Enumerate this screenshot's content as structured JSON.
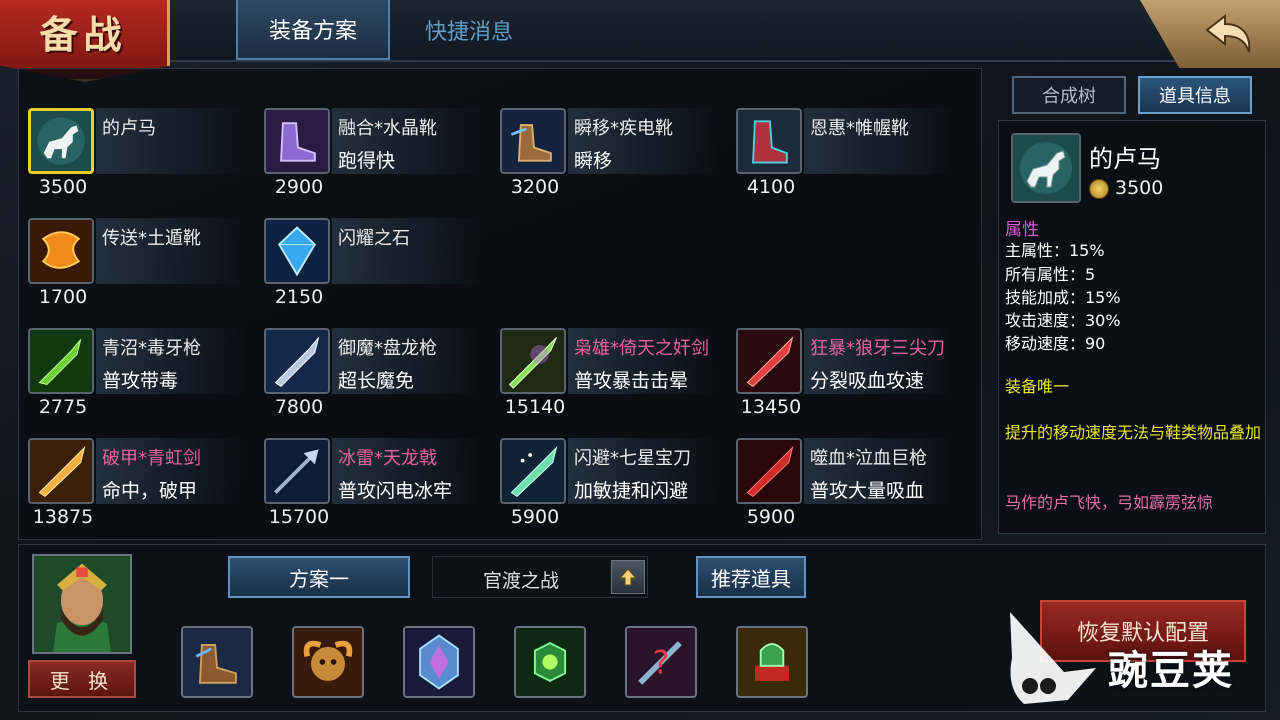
{
  "header": {
    "badge": "备战",
    "tabs": [
      {
        "label": "装备方案",
        "active": true
      },
      {
        "label": "快捷消息",
        "active": false
      }
    ]
  },
  "items": [
    {
      "name": "的卢马",
      "desc": "",
      "price": "3500",
      "name_color": "white",
      "icon": "horse-icon",
      "selected": true
    },
    {
      "name": "融合*水晶靴",
      "desc": "跑得快",
      "price": "2900",
      "name_color": "white",
      "icon": "crystal-boots-icon"
    },
    {
      "name": "瞬移*疾电靴",
      "desc": "瞬移",
      "price": "3200",
      "name_color": "white",
      "icon": "lightning-boots-icon"
    },
    {
      "name": "恩惠*帷幄靴",
      "desc": "",
      "price": "4100",
      "name_color": "white",
      "icon": "red-boots-icon"
    },
    {
      "name": "传送*土遁靴",
      "desc": "",
      "price": "1700",
      "name_color": "white",
      "icon": "fire-boots-icon"
    },
    {
      "name": "闪耀之石",
      "desc": "",
      "price": "2150",
      "name_color": "white",
      "icon": "gem-icon"
    },
    {
      "name": "青沼*毒牙枪",
      "desc": "普攻带毒",
      "price": "2775",
      "name_color": "white",
      "icon": "poison-spear-icon"
    },
    {
      "name": "御魔*盘龙枪",
      "desc": "超长魔免",
      "price": "7800",
      "name_color": "white",
      "icon": "dragon-spear-icon"
    },
    {
      "name": "枭雄*倚天之奸剑",
      "desc": "普攻暴击击晕",
      "price": "15140",
      "name_color": "pink",
      "icon": "green-sword-icon"
    },
    {
      "name": "狂暴*狼牙三尖刀",
      "desc": "分裂吸血攻速",
      "price": "13450",
      "name_color": "pink",
      "icon": "red-blade-icon"
    },
    {
      "name": "破甲*青虹剑",
      "desc": "命中，破甲",
      "price": "13875",
      "name_color": "pink",
      "icon": "golden-sword-icon"
    },
    {
      "name": "冰雷*天龙戟",
      "desc": "普攻闪电冰牢",
      "price": "15700",
      "name_color": "pink",
      "icon": "halberd-icon"
    },
    {
      "name": "闪避*七星宝刀",
      "desc": "加敏捷和闪避",
      "price": "5900",
      "name_color": "white",
      "icon": "seven-star-blade-icon"
    },
    {
      "name": "噬血*泣血巨枪",
      "desc": "普攻大量吸血",
      "price": "5900",
      "name_color": "white",
      "icon": "blood-spear-icon"
    }
  ],
  "right_tabs": [
    {
      "label": "合成树",
      "active": false
    },
    {
      "label": "道具信息",
      "active": true
    }
  ],
  "detail": {
    "name": "的卢马",
    "price": "3500",
    "attr_title": "属性",
    "attrs": [
      "主属性：15%",
      "所有属性：5",
      "技能加成：15%",
      "攻击速度：30%",
      "移动速度：90"
    ],
    "unique": "装备唯一",
    "note": "提升的移动速度无法与鞋类物品叠加",
    "lore": "马作的卢飞快，弓如霹雳弦惊"
  },
  "bottom": {
    "swap_label": "更 换",
    "plan_label": "方案一",
    "map_label": "官渡之战",
    "recommend_label": "推荐道具",
    "restore_label": "恢复默认配置",
    "slots": [
      "boots-icon",
      "ram-skull-icon",
      "crystal-armor-icon",
      "green-cube-icon",
      "mystery-icon",
      "jade-seal-icon"
    ]
  },
  "watermark": "豌豆荚",
  "colors": {
    "pink": "#e7619e",
    "selected_border": "#f0cf2c",
    "attr_title": "#d458d6",
    "unique": "#e8e62a"
  }
}
